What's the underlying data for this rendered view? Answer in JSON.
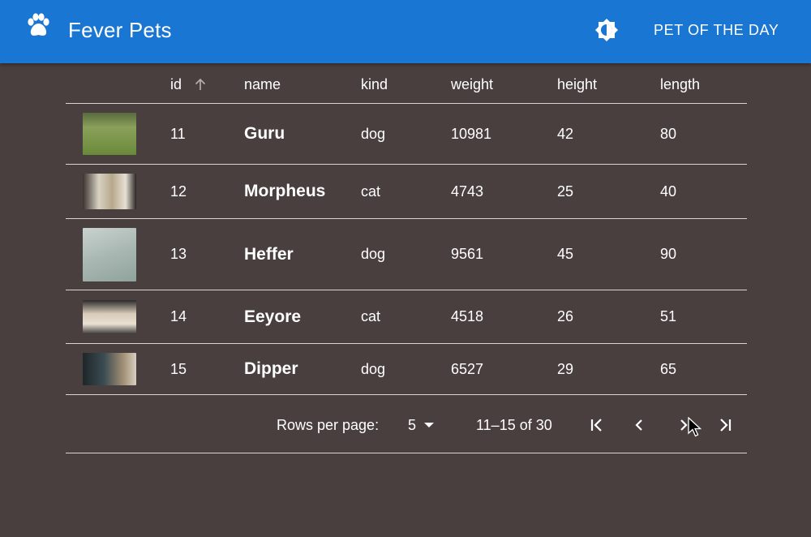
{
  "app": {
    "title": "Fever Pets",
    "pet_of_the_day_label": "PET OF THE DAY",
    "icons": {
      "logo": "paw-icon",
      "theme_toggle": "brightness-icon"
    }
  },
  "colors": {
    "appbar": "#1976d2",
    "background": "#4a3f3f",
    "text": "#ffffff",
    "divider": "#d9d4d4"
  },
  "table": {
    "columns": {
      "image": "",
      "id": "id",
      "name": "name",
      "kind": "kind",
      "weight": "weight",
      "height": "height",
      "length": "length"
    },
    "sort": {
      "column": "id",
      "direction": "ascending",
      "icon": "arrow-up-icon"
    },
    "rows": [
      {
        "id": "11",
        "name": "Guru",
        "kind": "dog",
        "weight": "10981",
        "height": "42",
        "length": "80"
      },
      {
        "id": "12",
        "name": "Morpheus",
        "kind": "cat",
        "weight": "4743",
        "height": "25",
        "length": "40"
      },
      {
        "id": "13",
        "name": "Heffer",
        "kind": "dog",
        "weight": "9561",
        "height": "45",
        "length": "90"
      },
      {
        "id": "14",
        "name": "Eeyore",
        "kind": "cat",
        "weight": "4518",
        "height": "26",
        "length": "51"
      },
      {
        "id": "15",
        "name": "Dipper",
        "kind": "dog",
        "weight": "6527",
        "height": "29",
        "length": "65"
      }
    ]
  },
  "pagination": {
    "rows_per_page_label": "Rows per page:",
    "rows_per_page_value": "5",
    "range": "11–15 of 30",
    "icons": {
      "first": "first-page-icon",
      "prev": "chevron-left-icon",
      "next": "chevron-right-icon",
      "last": "last-page-icon"
    }
  }
}
